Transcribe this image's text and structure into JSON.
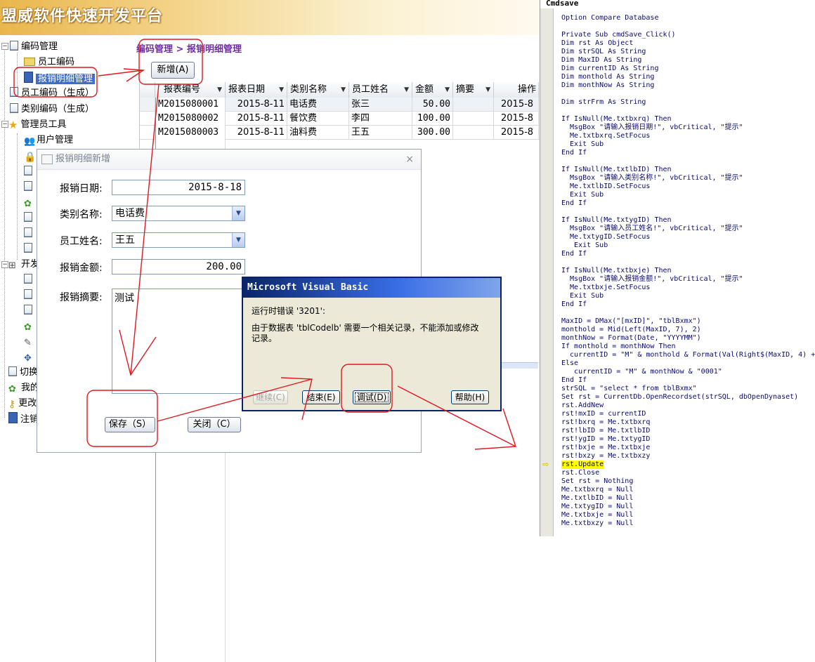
{
  "app": {
    "title": "盟威软件快速开发平台"
  },
  "nav": {
    "items": [
      {
        "label": "编码管理",
        "icon": "document-icon"
      },
      {
        "label": "员工编码",
        "icon": "folder-icon"
      },
      {
        "label": "报销明细管理",
        "icon": "book-icon"
      },
      {
        "label": "员工编码（生成）",
        "icon": "document-icon"
      },
      {
        "label": "类别编码（生成）",
        "icon": "document-icon"
      },
      {
        "label": "管理员工具",
        "icon": "star-icon"
      },
      {
        "label": "用户管理",
        "icon": "users-icon"
      },
      {
        "label": "开发",
        "icon": "tree-icon"
      },
      {
        "label": "切换",
        "icon": "document-icon"
      },
      {
        "label": "我的",
        "icon": "app-icon"
      },
      {
        "label": "更改",
        "icon": "key-icon"
      },
      {
        "label": "注销",
        "icon": "book-icon"
      }
    ]
  },
  "main": {
    "breadcrumb": "编码管理 > 报销明细管理",
    "new_button": "新增(A)",
    "columns": [
      "报表编号",
      "报表日期",
      "类别名称",
      "员工姓名",
      "金额",
      "摘要",
      "操作"
    ],
    "rows": [
      [
        "M2015080001",
        "2015-8-11",
        "电话费",
        "张三",
        "50.00",
        "",
        "2015-8"
      ],
      [
        "M2015080002",
        "2015-8-11",
        "餐饮费",
        "李四",
        "100.00",
        "",
        "2015-8"
      ],
      [
        "M2015080003",
        "2015-8-11",
        "油料费",
        "王五",
        "300.00",
        "",
        "2015-8"
      ]
    ]
  },
  "form": {
    "title": "报销明细新增",
    "close_glyph": "×",
    "date_label": "报销日期:",
    "date_value": "2015-8-18",
    "category_label": "类别名称:",
    "category_value": "电话费",
    "employee_label": "员工姓名:",
    "employee_value": "王五",
    "amount_label": "报销金额:",
    "amount_value": "200.00",
    "memo_label": "报销摘要:",
    "memo_value": "测试",
    "save_button": "保存（S）",
    "close_button": "关闭（C）"
  },
  "vb_error": {
    "title": "Microsoft Visual Basic",
    "line1": "运行时错误 '3201':",
    "line2": "由于数据表 'tblCodelb' 需要一个相关记录，不能添加或修改",
    "line3": "记录。",
    "continue_button": "继续(C)",
    "end_button": "结束(E)",
    "debug_button": "调试(D)",
    "help_button": "帮助(H)"
  },
  "code": {
    "title": "Cmdsave",
    "lines": [
      "Option Compare Database",
      "",
      "Private Sub cmdSave_Click()",
      "Dim rst As Object",
      "Dim strSQL As String",
      "Dim MaxID As String",
      "Dim currentID As String",
      "Dim monthold As String",
      "Dim monthNow As String",
      "",
      "Dim strFrm As String",
      "",
      "If IsNull(Me.txtbxrq) Then",
      "  MsgBox \"请输入报销日期!\", vbCritical, \"提示\"",
      "  Me.txtbxrq.SetFocus",
      "  Exit Sub",
      "End If",
      "",
      "If IsNull(Me.txtlbID) Then",
      "  MsgBox \"请输入类别名称!\", vbCritical, \"提示\"",
      "  Me.txtlbID.SetFocus",
      "  Exit Sub",
      "End If",
      "",
      "If IsNull(Me.txtygID) Then",
      "  MsgBox \"请输入员工姓名!\", vbCritical, \"提示\"",
      "  Me.txtygID.SetFocus",
      "   Exit Sub",
      "End If",
      "",
      "If IsNull(Me.txtbxje) Then",
      "  MsgBox \"请输入报销金额!\", vbCritical, \"提示\"",
      "  Me.txtbxje.SetFocus",
      "  Exit Sub",
      "End If",
      "",
      "MaxID = DMax(\"[mxID]\", \"tblBxmx\")",
      "monthold = Mid(Left(MaxID, 7), 2)",
      "monthNow = Format(Date, \"YYYYMM\")",
      "If monthold = monthNow Then",
      "  currentID = \"M\" & monthold & Format(Val(Right$(MaxID, 4) +",
      "Else",
      "   currentID = \"M\" & monthNow & \"0001\"",
      "End If",
      "strSQL = \"select * from tblBxmx\"",
      "Set rst = CurrentDb.OpenRecordset(strSQL, dbOpenDynaset)",
      "rst.AddNew",
      "rst!mxID = currentID",
      "rst!bxrq = Me.txtbxrq",
      "rst!lbID = Me.txtlbID",
      "rst!ygID = Me.txtygID",
      "rst!bxje = Me.txtbxje",
      "rst!bxzy = Me.txtbxzy",
      "rst.Update",
      "rst.Close",
      "Set rst = Nothing",
      "Me.txtbxrq = Null",
      "Me.txtlbID = Null",
      "Me.txtygID = Null",
      "Me.txtbxje = Null",
      "Me.txtbxzy = Null"
    ],
    "highlight_line": 53
  },
  "colors": {
    "annotation": "#e0191f",
    "selected_nav": "#3f6ec7",
    "breadcrumb": "#7030a0",
    "vb_titlebar": "#0a246a",
    "code_text": "#0b0b6b",
    "highlight": "#fffb00"
  }
}
